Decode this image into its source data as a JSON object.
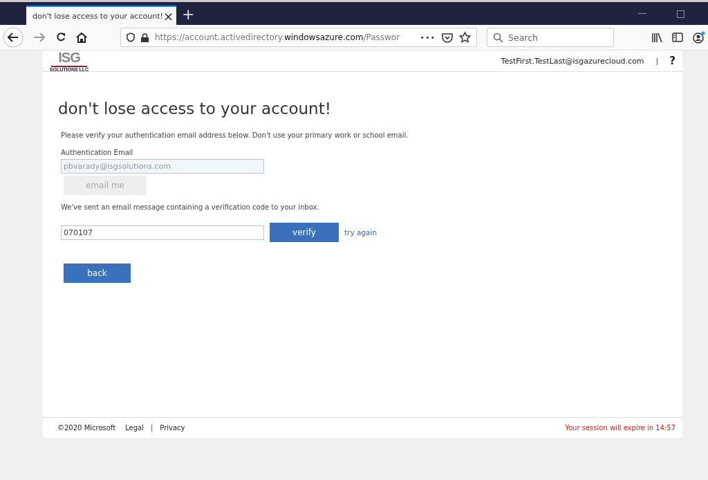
{
  "browser": {
    "tab": {
      "title": "don't lose access to your account!",
      "close": "×",
      "selected": true
    },
    "new_tab": "+",
    "url": {
      "prefix": "https://account.activedirectory.",
      "domain": "windowsazure.com",
      "path": "/Passwor"
    },
    "more": "•••",
    "search": {
      "placeholder": "Search"
    }
  },
  "header": {
    "logo": {
      "main": "ISG",
      "sub": "SOLUTIONS LLC"
    },
    "user": "TestFirst.TestLast@isgazurecloud.com",
    "separator": "|",
    "help": "?"
  },
  "title": "don't lose access to your account!",
  "intro": "Please verify your authentication email address below. Don't use your primary work or school email.",
  "email_label": "Authentication Email",
  "email_field": {
    "value": "pbvarady@isgsolutions.com",
    "disabled": true
  },
  "email_button": {
    "label": "email me",
    "disabled": true
  },
  "sent_message": "We've sent an email message containing a verification code to your inbox.",
  "code_field": {
    "value": "070107"
  },
  "verify_button": "verify",
  "try_again": "try again",
  "back_button": "back",
  "footer": {
    "copyright": "©2020 Microsoft",
    "links": [
      "Legal",
      "Privacy"
    ],
    "separator": "|",
    "session": "Your session will expire in 14:57"
  }
}
